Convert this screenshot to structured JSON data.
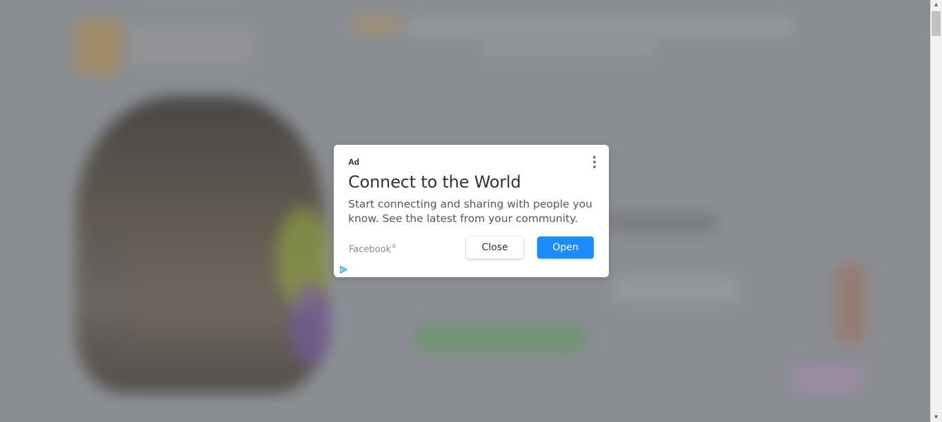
{
  "ad": {
    "label": "Ad",
    "headline": "Connect to the World",
    "body": "Start connecting and sharing with people you know. See the latest from your community.",
    "advertiser": "Facebook",
    "advertiser_mark": "®",
    "close_label": "Close",
    "open_label": "Open",
    "menu_icon": "more-vert-icon",
    "adchoices_icon": "adchoices-icon"
  },
  "colors": {
    "overlay": "#8d9094",
    "open_button": "#1a8cff",
    "adchoices": "#00aecd"
  },
  "scrollbar": {
    "up_arrow": "▲",
    "down_arrow": "▼"
  }
}
